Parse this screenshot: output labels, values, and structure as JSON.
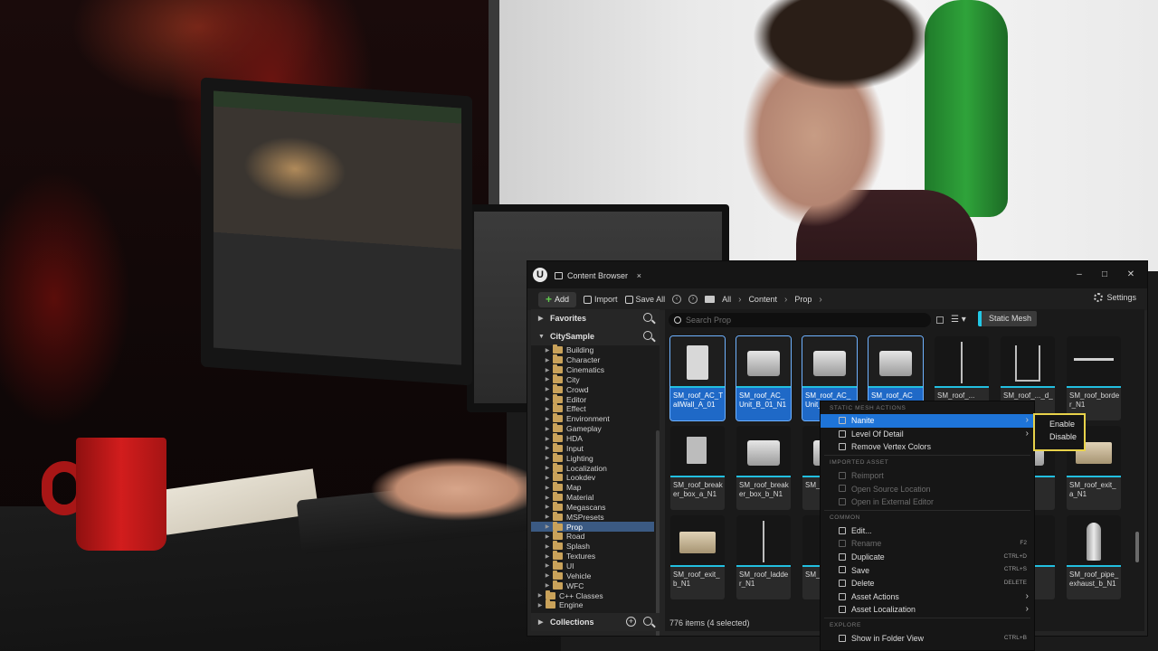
{
  "window": {
    "tab_title": "Content Browser",
    "close_glyph": "×",
    "controls": {
      "minimize": "–",
      "maximize": "□",
      "close": "✕"
    }
  },
  "toolbar": {
    "add_label": "Add",
    "import_label": "Import",
    "save_all_label": "Save All",
    "breadcrumb": [
      "All",
      "Content",
      "Prop"
    ],
    "settings_label": "Settings"
  },
  "sidebar": {
    "favorites_label": "Favorites",
    "project_label": "CitySample",
    "collections_label": "Collections",
    "tree": [
      {
        "label": "Building",
        "depth": 1
      },
      {
        "label": "Character",
        "depth": 1
      },
      {
        "label": "Cinematics",
        "depth": 1
      },
      {
        "label": "City",
        "depth": 1
      },
      {
        "label": "Crowd",
        "depth": 1
      },
      {
        "label": "Editor",
        "depth": 1
      },
      {
        "label": "Effect",
        "depth": 1
      },
      {
        "label": "Environment",
        "depth": 1
      },
      {
        "label": "Gameplay",
        "depth": 1
      },
      {
        "label": "HDA",
        "depth": 1
      },
      {
        "label": "Input",
        "depth": 1
      },
      {
        "label": "Lighting",
        "depth": 1
      },
      {
        "label": "Localization",
        "depth": 1
      },
      {
        "label": "Lookdev",
        "depth": 1
      },
      {
        "label": "Map",
        "depth": 1
      },
      {
        "label": "Material",
        "depth": 1
      },
      {
        "label": "Megascans",
        "depth": 1
      },
      {
        "label": "MSPresets",
        "depth": 1
      },
      {
        "label": "Prop",
        "depth": 1,
        "selected": true
      },
      {
        "label": "Road",
        "depth": 1
      },
      {
        "label": "Splash",
        "depth": 1
      },
      {
        "label": "Textures",
        "depth": 1
      },
      {
        "label": "UI",
        "depth": 1
      },
      {
        "label": "Vehicle",
        "depth": 1
      },
      {
        "label": "WFC",
        "depth": 1
      },
      {
        "label": "C++ Classes",
        "depth": 0
      },
      {
        "label": "Engine",
        "depth": 0
      }
    ]
  },
  "search": {
    "placeholder": "Search Prop",
    "value": ""
  },
  "filter_chip": {
    "label": "Static Mesh",
    "color": "#22c8e6"
  },
  "assets": [
    {
      "label": "SM_roof_AC_TallWall_A_01",
      "selected": true
    },
    {
      "label": "SM_roof_AC_Unit_B_01_N1",
      "selected": true
    },
    {
      "label": "SM_roof_AC_Unit_..._N1",
      "selected": true
    },
    {
      "label": "SM_roof_AC_...",
      "selected": true
    },
    {
      "label": "SM_roof_...",
      "selected": false
    },
    {
      "label": "SM_roof_..._d_N1",
      "selected": false
    },
    {
      "label": "SM_roof_border_N1",
      "selected": false
    },
    {
      "label": "SM_roof_breaker_box_a_N1",
      "selected": false
    },
    {
      "label": "SM_roof_breaker_box_b_N1",
      "selected": false
    },
    {
      "label": "SM_r..._N1",
      "selected": false
    },
    {
      "label": "",
      "selected": false
    },
    {
      "label": "",
      "selected": false
    },
    {
      "label": "..._a_N1",
      "selected": false
    },
    {
      "label": "SM_roof_exit_a_N1",
      "selected": false
    },
    {
      "label": "SM_roof_exit_b_N1",
      "selected": false
    },
    {
      "label": "SM_roof_ladder_N1",
      "selected": false
    },
    {
      "label": "SM_r..._a_N1",
      "selected": false
    },
    {
      "label": "",
      "selected": false
    },
    {
      "label": "",
      "selected": false
    },
    {
      "label": "..._Pipe",
      "selected": false
    },
    {
      "label": "SM_roof_pipe_exhaust_b_N1",
      "selected": false
    }
  ],
  "status": {
    "text": "776 items (4 selected)"
  },
  "context_menu": {
    "sections": [
      {
        "title": "STATIC MESH ACTIONS",
        "items": [
          {
            "label": "Nanite",
            "icon": "wrench-icon",
            "submenu": true,
            "highlighted": true
          },
          {
            "label": "Level Of Detail",
            "icon": "lod-icon",
            "submenu": true
          },
          {
            "label": "Remove Vertex Colors",
            "icon": "vertex-icon"
          }
        ]
      },
      {
        "title": "IMPORTED ASSET",
        "items": [
          {
            "label": "Reimport",
            "icon": "reimport-icon",
            "disabled": true
          },
          {
            "label": "Open Source Location",
            "icon": "folder-icon",
            "disabled": true
          },
          {
            "label": "Open in External Editor",
            "icon": "external-icon",
            "disabled": true
          }
        ]
      },
      {
        "title": "COMMON",
        "items": [
          {
            "label": "Edit...",
            "icon": "edit-icon"
          },
          {
            "label": "Rename",
            "icon": "rename-icon",
            "disabled": true,
            "shortcut": "F2"
          },
          {
            "label": "Duplicate",
            "icon": "duplicate-icon",
            "shortcut": "CTRL+D"
          },
          {
            "label": "Save",
            "icon": "save-icon",
            "shortcut": "CTRL+S"
          },
          {
            "label": "Delete",
            "icon": "trash-icon",
            "shortcut": "DELETE"
          },
          {
            "label": "Asset Actions",
            "icon": "wrench-icon",
            "submenu": true
          },
          {
            "label": "Asset Localization",
            "icon": "flag-icon",
            "submenu": true
          }
        ]
      },
      {
        "title": "EXPLORE",
        "items": [
          {
            "label": "Show in Folder View",
            "icon": "folder-icon",
            "shortcut": "CTRL+B"
          }
        ]
      }
    ]
  },
  "nanite_submenu": [
    "Enable",
    "Disable"
  ],
  "colors": {
    "accent": "#1e74d8",
    "selection": "#1f69c7",
    "static_mesh": "#22bfe0",
    "highlight_outline": "#e8d24a"
  }
}
